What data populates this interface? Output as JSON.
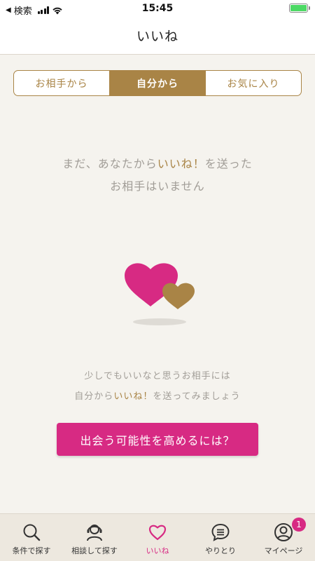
{
  "status_bar": {
    "back_label": "検索",
    "time": "15:45",
    "battery_level": 1.0
  },
  "header": {
    "title": "いいね"
  },
  "segments": [
    {
      "label": "お相手から",
      "active": false
    },
    {
      "label": "自分から",
      "active": true
    },
    {
      "label": "お気に入り",
      "active": false
    }
  ],
  "empty_state": {
    "line1_pre": "まだ、あなたから",
    "line1_accent": "いいね！",
    "line1_post": "を送った",
    "line2": "お相手はいません",
    "sub_line1": "少しでもいいなと思うお相手には",
    "sub_line2_pre": "自分から",
    "sub_line2_accent": "いいね！",
    "sub_line2_post": "を送ってみましょう",
    "cta_label": "出会う可能性を高めるには？"
  },
  "tabs": [
    {
      "label": "条件で探す",
      "icon": "search-icon"
    },
    {
      "label": "相談して探す",
      "icon": "concierge-icon"
    },
    {
      "label": "いいね",
      "icon": "heart-icon",
      "active": true
    },
    {
      "label": "やりとり",
      "icon": "chat-icon"
    },
    {
      "label": "マイページ",
      "icon": "user-icon",
      "badge": "1"
    }
  ],
  "colors": {
    "accent_gold": "#a98446",
    "accent_pink": "#d72a83",
    "background": "#f5f3ee",
    "muted_text": "#a19d97"
  }
}
